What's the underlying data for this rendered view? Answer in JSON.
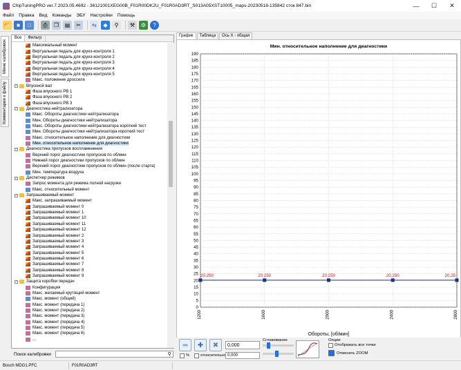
{
  "window": {
    "title": "ChipTuningPRO ver.7.2023.05.4692 - 36121001XEG00B_F01R00DK2U_F01R0AD3RT_S013A05XST10005_maps-20230518-135842 сток 847.bin"
  },
  "menu": [
    "Файл",
    "Правка",
    "Вид",
    "Команды",
    "ЭБУ",
    "Настройки",
    "Помощь"
  ],
  "toolbar": {
    "icons": [
      "open-icon",
      "save-icon",
      "save-as-icon",
      "print-icon",
      "copy-icon",
      "paste-icon",
      "cut-icon",
      "compare-icon",
      "checksum-icon",
      "search-icon",
      "tools-icon",
      "settings-icon",
      "help-icon"
    ]
  },
  "left_tabs": [
    "Меню калибровок",
    "Комментарии к файлу"
  ],
  "tree_tabs": [
    "Все",
    "Фильтр"
  ],
  "tree": [
    {
      "label": "Максимальный момент",
      "level": 2,
      "icon": "map3d"
    },
    {
      "label": "Виртуальная педаль для круиз-контроля 1",
      "level": 2,
      "icon": "map3d"
    },
    {
      "label": "Виртуальная педаль для круиз-контроля 2",
      "level": 2,
      "icon": "map3d"
    },
    {
      "label": "Виртуальная педаль для круиз-контроля 3",
      "level": 2,
      "icon": "map3d"
    },
    {
      "label": "Виртуальная педаль для круиз-контроля 4",
      "level": 2,
      "icon": "map3d"
    },
    {
      "label": "Виртуальная педаль для круиз-контроля 5",
      "level": 2,
      "icon": "map3d"
    },
    {
      "label": "Макс. положение дросселя",
      "level": 2,
      "icon": "val"
    },
    {
      "label": "Впускной вал",
      "level": 1,
      "icon": "folder",
      "exp": "-"
    },
    {
      "label": "Фаза впускного РВ 1",
      "level": 2,
      "icon": "map3d"
    },
    {
      "label": "Фаза впускного РВ 2",
      "level": 2,
      "icon": "map3d"
    },
    {
      "label": "Фаза впускного РВ 3",
      "level": 2,
      "icon": "map3d"
    },
    {
      "label": "Диагностика нейтрализатора",
      "level": 1,
      "icon": "folder",
      "exp": "-"
    },
    {
      "label": "Макс. Обороты диагностики нейтрализатора",
      "level": 2,
      "icon": "tbl"
    },
    {
      "label": "Мин. Обороты диагностики нейтрализатора",
      "level": 2,
      "icon": "tbl"
    },
    {
      "label": "Макс. Обороты диагностики нейтрализатора короткий тест",
      "level": 2,
      "icon": "tbl"
    },
    {
      "label": "Мин. Обороты диагностики нейтрализатора короткий тест",
      "level": 2,
      "icon": "tbl"
    },
    {
      "label": "Макс. относительное наполнение для диагностики",
      "level": 2,
      "icon": "val"
    },
    {
      "label": "Мин. относительное наполнение для диагностики",
      "level": 2,
      "icon": "val",
      "selected": true
    },
    {
      "label": "Диагностика пропусков воспламенения",
      "level": 1,
      "icon": "folder",
      "exp": "-"
    },
    {
      "label": "Верхний порог диагностики пропусков по об/мин",
      "level": 2,
      "icon": "val"
    },
    {
      "label": "Нижний порог диагностики пропусков по об/мин",
      "level": 2,
      "icon": "val"
    },
    {
      "label": "Верхний порог диагностики пропусков по об/мин (после старта)",
      "level": 2,
      "icon": "val"
    },
    {
      "label": "Мин. температура воздуха",
      "level": 2,
      "icon": "tbl"
    },
    {
      "label": "Диспетчер режимов",
      "level": 1,
      "icon": "folder",
      "exp": "-"
    },
    {
      "label": "Запрос момента для режима полной нагрузки",
      "level": 2,
      "icon": "val"
    },
    {
      "label": "Макс. относительный момент",
      "level": 2,
      "icon": "tbl"
    },
    {
      "label": "Запрашиваемый момент",
      "level": 1,
      "icon": "folder",
      "exp": "-"
    },
    {
      "label": "Макс. запрашиваемый момент",
      "level": 2,
      "icon": "map3d"
    },
    {
      "label": "Запрашиваемый момент 0",
      "level": 2,
      "icon": "map3d"
    },
    {
      "label": "Запрашиваемый момент 1",
      "level": 2,
      "icon": "map3d"
    },
    {
      "label": "Запрашиваемый момент 10",
      "level": 2,
      "icon": "map3d"
    },
    {
      "label": "Запрашиваемый момент 11",
      "level": 2,
      "icon": "map3d"
    },
    {
      "label": "Запрашиваемый момент 12",
      "level": 2,
      "icon": "map3d"
    },
    {
      "label": "Запрашиваемый момент 2",
      "level": 2,
      "icon": "map3d"
    },
    {
      "label": "Запрашиваемый момент 3",
      "level": 2,
      "icon": "map3d"
    },
    {
      "label": "Запрашиваемый момент 4",
      "level": 2,
      "icon": "map3d"
    },
    {
      "label": "Запрашиваемый момент 5",
      "level": 2,
      "icon": "map3d"
    },
    {
      "label": "Запрашиваемый момент 6",
      "level": 2,
      "icon": "map3d"
    },
    {
      "label": "Запрашиваемый момент 7",
      "level": 2,
      "icon": "map3d"
    },
    {
      "label": "Запрашиваемый момент 8",
      "level": 2,
      "icon": "map3d"
    },
    {
      "label": "Запрашиваемый момент 9",
      "level": 2,
      "icon": "map3d"
    },
    {
      "label": "Защита коробки передач",
      "level": 1,
      "icon": "folder",
      "exp": "-"
    },
    {
      "label": "Конфигурация",
      "level": 2,
      "icon": "val"
    },
    {
      "label": "Макс. желаемый крутящий момент",
      "level": 2,
      "icon": "val"
    },
    {
      "label": "Макс. момент (общий)",
      "level": 2,
      "icon": "tbl"
    },
    {
      "label": "Макс. момент (передача 1)",
      "level": 2,
      "icon": "val"
    },
    {
      "label": "Макс. момент (передача 2)",
      "level": 2,
      "icon": "val"
    },
    {
      "label": "Макс. момент (передача 3)",
      "level": 2,
      "icon": "val"
    },
    {
      "label": "Макс. момент (передача 4)",
      "level": 2,
      "icon": "val"
    },
    {
      "label": "Макс. момент (передача 5)",
      "level": 2,
      "icon": "val"
    },
    {
      "label": "Макс. момент (передача 6)",
      "level": 2,
      "icon": "val"
    },
    {
      "label": "...",
      "level": 2,
      "icon": "val"
    }
  ],
  "search": {
    "label": "Поиск калибровки",
    "value": ""
  },
  "chart_tabs": [
    "График",
    "Таблица",
    "Ось X - общая"
  ],
  "chart_data": {
    "type": "line",
    "title": "Мин. относительное наполнение для диагностики",
    "xlabel": "Обороты, [об/мин]",
    "ylabel": "",
    "xlim": [
      1200,
      2800
    ],
    "ylim": [
      0,
      190
    ],
    "yticks": [
      0,
      5,
      10,
      15,
      20,
      25,
      30,
      35,
      40,
      45,
      50,
      55,
      60,
      65,
      70,
      75,
      80,
      85,
      90,
      95,
      100,
      105,
      110,
      115,
      120,
      125,
      130,
      135,
      140,
      145,
      150,
      155,
      160,
      165,
      170,
      175,
      180,
      185,
      190
    ],
    "xticks": [
      1200,
      1600,
      2000,
      2400,
      2800
    ],
    "x": [
      1200,
      1600,
      2000,
      2400,
      2800
    ],
    "values": [
      20.25,
      20.25,
      20.25,
      20.25,
      20.25
    ],
    "point_labels": [
      "20.250",
      "20.250",
      "20.250",
      "20.250",
      "20.25"
    ],
    "line_color": "#1b2f8c",
    "grid": true
  },
  "bottom": {
    "value1": "0,000",
    "percent_label": "%",
    "relative_label": "относительно",
    "value2": "0,000",
    "smoothing_label": "Сглаживание",
    "options_label": "Опции",
    "show_all_points": "Отображать все точки",
    "cancel_zoom": "Отменить ZOOM"
  },
  "status": {
    "ecu": "Bosch MDG1.PFC",
    "sw": "F01R0AD3RT"
  }
}
